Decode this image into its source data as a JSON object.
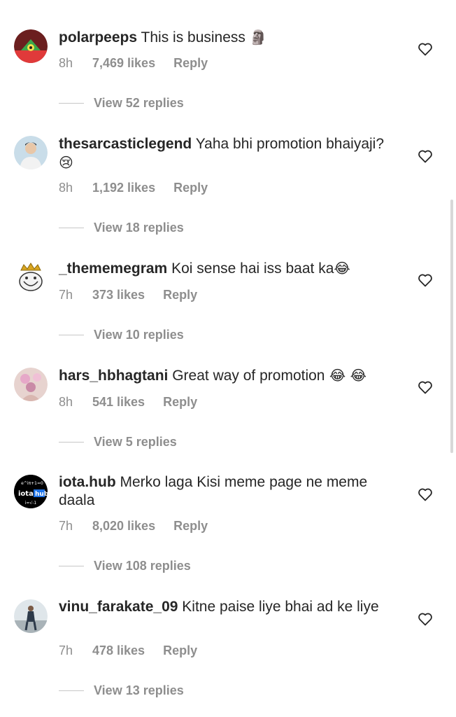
{
  "comments": [
    {
      "username": "polarpeeps",
      "text": "This is business",
      "emoji": "🗿",
      "time": "8h",
      "likes": "7,469 likes",
      "reply": "Reply",
      "view_replies": "View 52 replies"
    },
    {
      "username": "thesarcasticlegend",
      "text": "Yaha bhi promotion bhaiyaji?",
      "emoji": "😢",
      "time": "8h",
      "likes": "1,192 likes",
      "reply": "Reply",
      "view_replies": "View 18 replies"
    },
    {
      "username": "_thememegram",
      "text": "Koi sense hai iss baat ka",
      "emoji": "😂",
      "time": "7h",
      "likes": "373 likes",
      "reply": "Reply",
      "view_replies": "View 10 replies"
    },
    {
      "username": "hars_hbhagtani",
      "text": "Great way of promotion",
      "emoji": " 😂 😂",
      "time": "8h",
      "likes": "541 likes",
      "reply": "Reply",
      "view_replies": "View 5 replies"
    },
    {
      "username": "iota.hub",
      "text": "Merko laga Kisi meme page ne meme daala",
      "emoji": "",
      "time": "7h",
      "likes": "8,020 likes",
      "reply": "Reply",
      "view_replies": "View 108 replies",
      "avatar_text": [
        "e^iπ+1=0",
        "iota",
        "hub",
        "i=√-1"
      ]
    },
    {
      "username": "vinu_farakate_09",
      "text": "Kitne paise liye bhai ad ke liye",
      "emoji": "",
      "time": "7h",
      "likes": "478 likes",
      "reply": "Reply",
      "view_replies": "View 13 replies"
    }
  ],
  "icons": {
    "like": "heart-outline-icon"
  },
  "colors": {
    "text": "#262626",
    "secondary": "#8e8e8e",
    "divider": "#c7c7c7"
  }
}
